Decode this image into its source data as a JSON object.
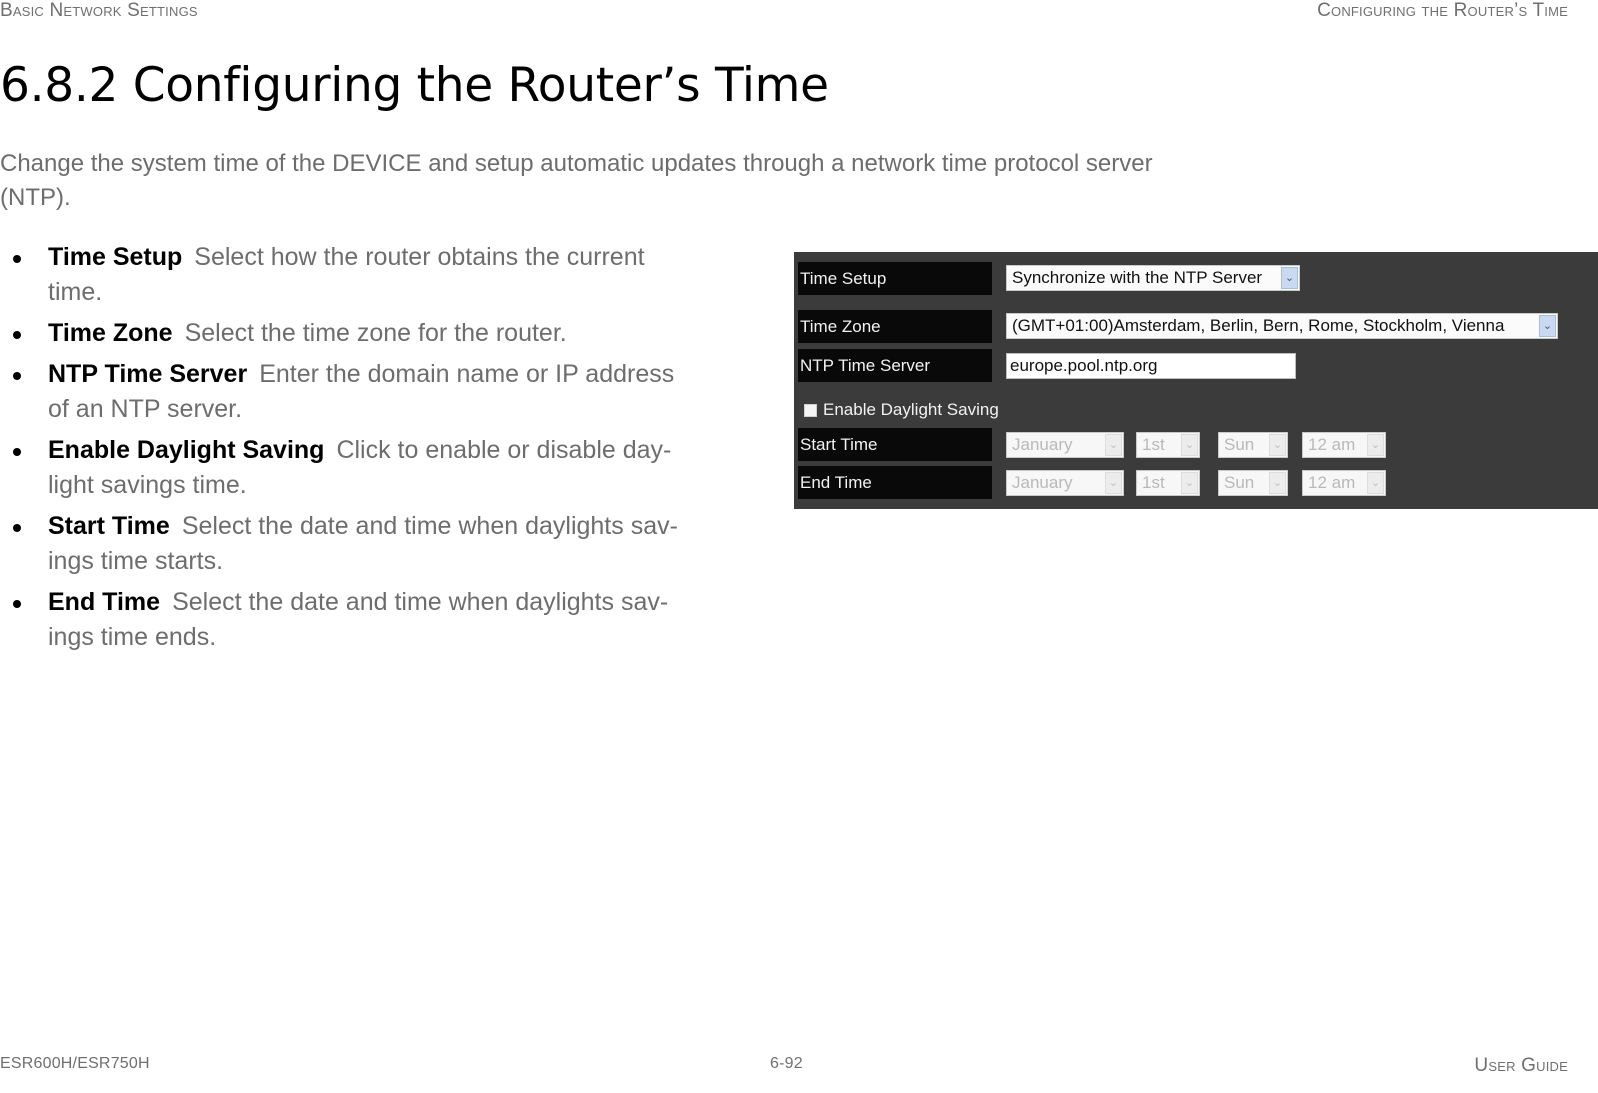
{
  "header": {
    "left": "Basic Network Settings",
    "right": "Configuring the Router’s Time"
  },
  "title": "6.8.2 Configuring the Router’s Time",
  "intro": {
    "line1": "Change the system time of the DEVICE and setup automatic updates through a network time protocol server",
    "line2": "(NTP)."
  },
  "bullets": [
    {
      "term": "Time Setup",
      "line1": "Select how the router obtains the current",
      "line2": "time."
    },
    {
      "term": "Time Zone",
      "line1": "Select the time zone for the router.",
      "line2": ""
    },
    {
      "term": "NTP Time Server",
      "line1": "Enter the domain name or IP address",
      "line2": "of an NTP server."
    },
    {
      "term": "Enable Daylight Saving",
      "line1": "Click to enable or disable day-",
      "line2": "light savings time."
    },
    {
      "term": "Start Time",
      "line1": "Select the date and time when daylights sav-",
      "line2": "ings time starts."
    },
    {
      "term": "End Time",
      "line1": "Select the date and time when daylights sav-",
      "line2": "ings time ends."
    }
  ],
  "router_ui": {
    "time_setup": {
      "label": "Time Setup",
      "value": "Synchronize with the NTP Server"
    },
    "time_zone": {
      "label": "Time Zone",
      "value": "(GMT+01:00)Amsterdam, Berlin, Bern, Rome, Stockholm, Vienna"
    },
    "ntp_server": {
      "label": "NTP Time Server",
      "value": "europe.pool.ntp.org"
    },
    "daylight_saving": {
      "label": "Enable Daylight Saving",
      "checked": false
    },
    "start_time": {
      "label": "Start Time",
      "month": "January",
      "week": "1st",
      "day": "Sun",
      "hour": "12 am"
    },
    "end_time": {
      "label": "End Time",
      "month": "January",
      "week": "1st",
      "day": "Sun",
      "hour": "12 am"
    },
    "arrow_glyph": "⌄"
  },
  "footer": {
    "left": "ESR600H/ESR750H",
    "center": "6-92",
    "right": "User Guide"
  }
}
